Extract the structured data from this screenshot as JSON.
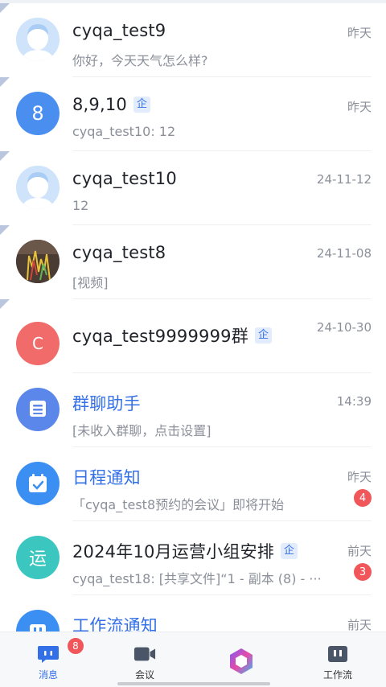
{
  "conversations": [
    {
      "title": "cyqa_test9",
      "subtitle": "你好，今天天气怎么样?",
      "time": "昨天",
      "avatar": "person-avatar",
      "pinned": true
    },
    {
      "title": "8,9,10",
      "enterprise_tag": "企",
      "subtitle": "cyqa_test10: 12",
      "time": "昨天",
      "avatar_text": "8",
      "avatar_color": "#4a8ff0",
      "pinned": true
    },
    {
      "title": "cyqa_test10",
      "subtitle": "12",
      "time": "24-11-12",
      "avatar": "person-avatar",
      "pinned": true
    },
    {
      "title": "cyqa_test8",
      "subtitle": "[视频]",
      "time": "24-11-08",
      "avatar": "photo-avatar",
      "pinned": true
    },
    {
      "title": "cyqa_test9999999群",
      "enterprise_tag": "企",
      "subtitle": "",
      "time": "24-10-30",
      "avatar_text": "C",
      "avatar_color": "#f26b6b",
      "pinned": true
    },
    {
      "title": "群聊助手",
      "subtitle": "[未收入群聊，点击设置]",
      "time": "14:39",
      "avatar": "group-helper-icon",
      "avatar_color": "#5b86ea",
      "pinned": false
    },
    {
      "title": "日程通知",
      "subtitle": "「cyqa_test8预约的会议」即将开始",
      "time": "昨天",
      "badge": "4",
      "avatar": "calendar-icon",
      "avatar_color": "#3c8ff2",
      "pinned": false
    },
    {
      "title": "2024年10月运营小组安排",
      "enterprise_tag": "企",
      "subtitle": "cyqa_test18: [共享文件]“1 - 副本 (8) - ···",
      "time": "前天",
      "badge": "3",
      "avatar_text": "运",
      "avatar_color": "#3cc6c0",
      "pinned": false
    },
    {
      "title": "工作流通知",
      "subtitle": "",
      "time": "前天",
      "avatar": "workflow-icon",
      "avatar_color": "#3c8ff2",
      "pinned": false
    }
  ],
  "tabbar": {
    "messages": {
      "label": "消息",
      "badge": "8",
      "active": true
    },
    "meeting": {
      "label": "会议"
    },
    "center": {
      "icon": "app-logo-icon"
    },
    "workflow": {
      "label": "工作流"
    }
  },
  "colors": {
    "accent": "#3370e8",
    "badge": "#f0565a"
  }
}
